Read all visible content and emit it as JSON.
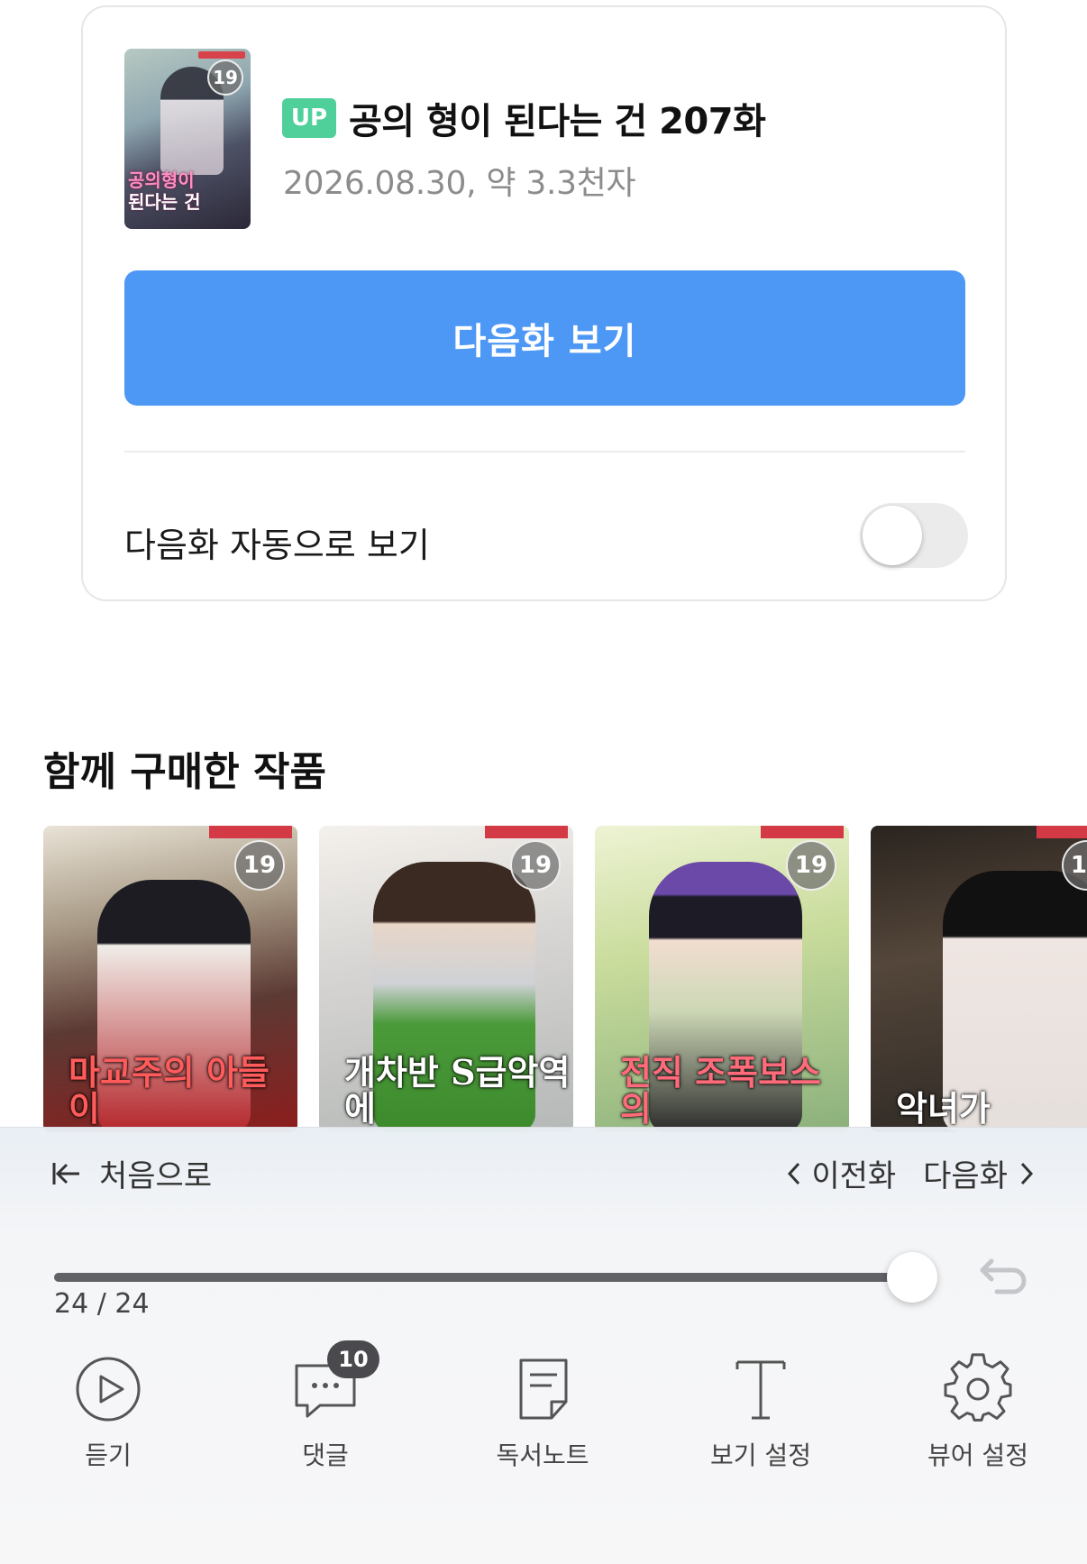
{
  "episode": {
    "age_rating": "19",
    "cover_title_line1": "공의형이",
    "cover_title_line2": "된다는 건",
    "badge": "UP",
    "title": "공의 형이 된다는 건 207화",
    "meta": "2026.08.30, 약 3.3천자",
    "next_button_label": "다음화 보기",
    "auto_next_label": "다음화 자동으로 보기",
    "auto_next_enabled": false
  },
  "recommendations": {
    "title": "함께 구매한 작품",
    "items": [
      {
        "age_rating": "19",
        "title_text": "마교주의 아들이"
      },
      {
        "age_rating": "19",
        "title_text": "개차반 S급악역에"
      },
      {
        "age_rating": "19",
        "title_text": "전직 조폭보스의"
      },
      {
        "age_rating": "19",
        "title_text": "악녀가"
      }
    ]
  },
  "toolbar": {
    "first_label": "처음으로",
    "prev_label": "이전화",
    "next_label": "다음화",
    "progress_fraction": 1.0,
    "page_count": "24 / 24",
    "buttons": [
      {
        "label": "듣기",
        "icon": "play-circle-icon"
      },
      {
        "label": "댓글",
        "icon": "comment-icon",
        "badge": "10"
      },
      {
        "label": "독서노트",
        "icon": "note-icon"
      },
      {
        "label": "보기 설정",
        "icon": "text-format-icon"
      },
      {
        "label": "뷰어 설정",
        "icon": "gear-icon"
      }
    ]
  },
  "colors": {
    "accent_blue": "#4e98f5",
    "up_badge_green": "#4fcf9a"
  }
}
